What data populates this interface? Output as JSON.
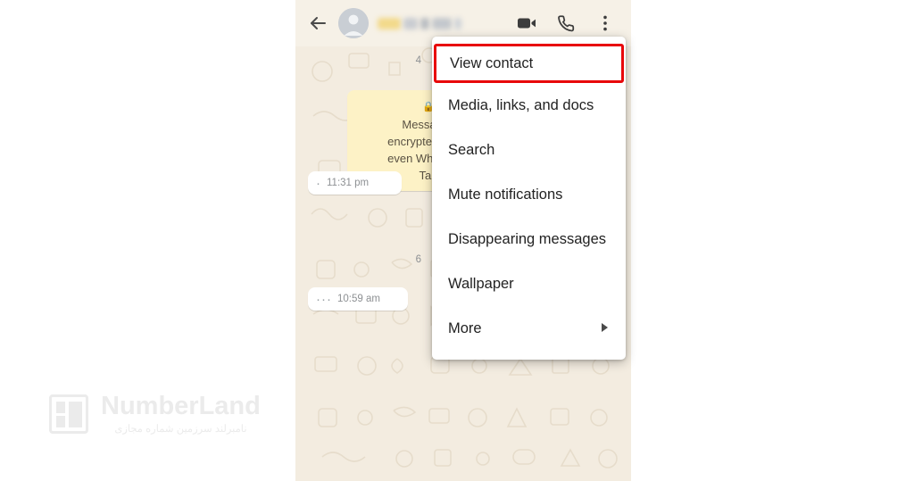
{
  "app": {
    "name": "WhatsApp chat screen",
    "appbar": {
      "back_icon": "arrow-left-icon",
      "avatar_icon": "contact-avatar",
      "contact_name_redacted": "",
      "video_call_icon": "video-camera-icon",
      "voice_call_icon": "phone-icon",
      "overflow_icon": "more-vertical-icon"
    },
    "chat": {
      "date_stamp_top": "4 ",
      "system_message": "Messages\nencrypted. No o\neven WhatsApp\nTap",
      "system_message_lines": [
        "Messages",
        "encrypted. No o",
        "even WhatsApp",
        "Tap"
      ],
      "lock_icon": "lock-icon",
      "messages": [
        {
          "time": "11:31 pm",
          "dots": "·"
        },
        {
          "time": "10:59 am",
          "dots": "···"
        }
      ],
      "date_stamp_mid": "6 "
    },
    "menu": {
      "items": [
        {
          "label": "View contact",
          "highlighted": true,
          "submenu": false
        },
        {
          "label": "Media, links, and docs",
          "highlighted": false,
          "submenu": false
        },
        {
          "label": "Search",
          "highlighted": false,
          "submenu": false
        },
        {
          "label": "Mute notifications",
          "highlighted": false,
          "submenu": false
        },
        {
          "label": "Disappearing messages",
          "highlighted": false,
          "submenu": false
        },
        {
          "label": "Wallpaper",
          "highlighted": false,
          "submenu": false
        },
        {
          "label": "More",
          "highlighted": false,
          "submenu": true,
          "submenu_icon": "chevron-right-icon"
        }
      ],
      "highlight_color": "#e8060a"
    },
    "watermark": {
      "brand": "NumberLand",
      "tagline": "نامبرلند سرزمین شماره مجازی",
      "logo_icon": "numberland-logo-icon",
      "color": "#ebebeb"
    },
    "colors": {
      "chat_background": "#f3ece0",
      "appbar_background": "#f6f1e7",
      "system_bubble": "#fdf2c6",
      "incoming_bubble": "#ffffff",
      "page_background": "#ffffff"
    }
  }
}
